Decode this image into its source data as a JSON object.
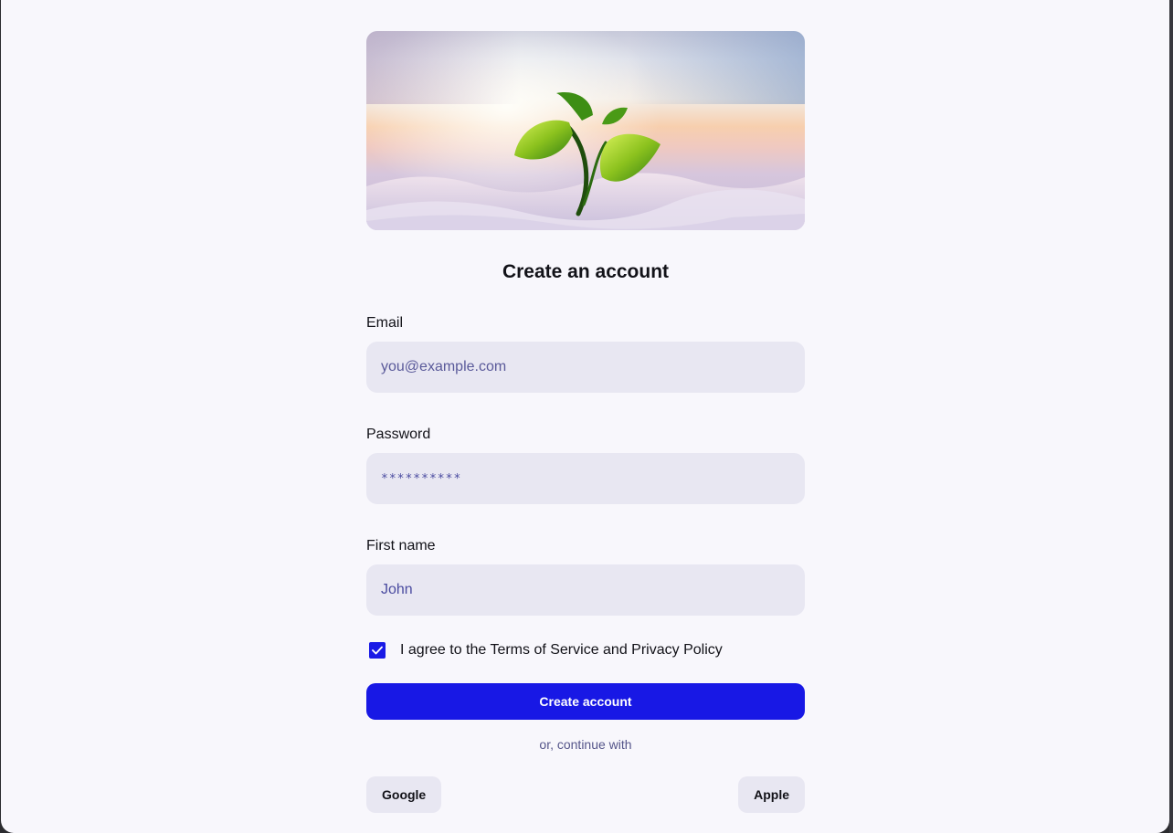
{
  "heading": "Create an account",
  "fields": {
    "email": {
      "label": "Email",
      "placeholder": "you@example.com",
      "value": ""
    },
    "password": {
      "label": "Password",
      "value": "**********"
    },
    "first_name": {
      "label": "First name",
      "value": "John"
    }
  },
  "agree": {
    "label": "I agree to the Terms of Service and Privacy Policy",
    "checked": true
  },
  "primary_button": "Create account",
  "divider": "or, continue with",
  "social": {
    "google": "Google",
    "apple": "Apple"
  },
  "colors": {
    "accent": "#1818e5",
    "input_bg": "#e8e7f2",
    "page_bg": "#f8f7fc"
  },
  "icons": {
    "hero": "seedling-sprout-image",
    "checkbox": "checkmark-icon"
  }
}
